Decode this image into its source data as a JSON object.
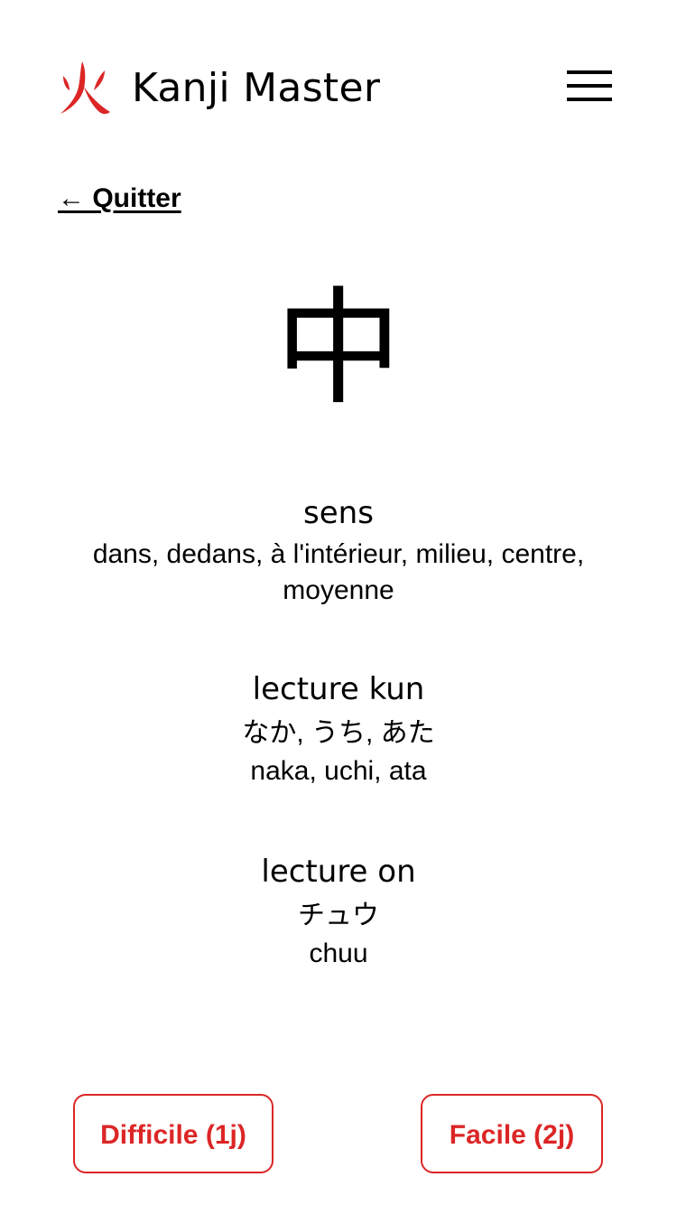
{
  "app": {
    "title": "Kanji Master",
    "logo_icon": "fire-kanji-logo-icon",
    "menu_icon": "hamburger-menu-icon",
    "accent_color": "#dc2626"
  },
  "nav": {
    "back_label": "← Quitter"
  },
  "card": {
    "kanji": "中",
    "meaning": {
      "heading": "sens",
      "text": "dans, dedans, à l'intérieur, milieu, centre, moyenne"
    },
    "kun": {
      "heading": "lecture kun",
      "kana": "なか, うち, あた",
      "romaji": "naka, uchi, ata"
    },
    "on": {
      "heading": "lecture on",
      "kana": "チュウ",
      "romaji": "chuu"
    }
  },
  "actions": {
    "hard_label": "Difficile (1j)",
    "easy_label": "Facile (2j)"
  }
}
